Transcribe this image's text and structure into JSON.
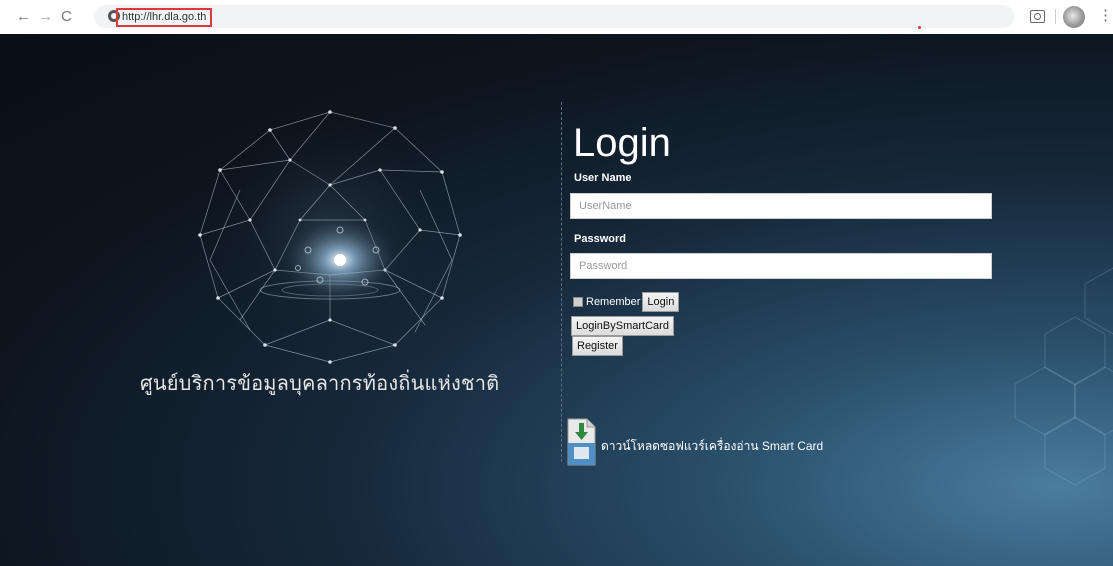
{
  "browser": {
    "url": "http://lhr.dla.go.th",
    "back_icon": "←",
    "forward_icon": "→",
    "reload_icon": "C",
    "menu_icon": "⋮"
  },
  "site": {
    "title": "ศูนย์บริการข้อมูลบุคลากรท้องถิ่นแห่งชาติ"
  },
  "login": {
    "heading": "Login",
    "username_label": "User Name",
    "username_placeholder": "UserName",
    "password_label": "Password",
    "password_placeholder": "Password",
    "remember_label": "Remember",
    "login_button": "Login",
    "smartcard_button": "LoginBySmartCard",
    "register_button": "Register"
  },
  "download": {
    "text": "ดาวน์โหลดซอฟแวร์เครื่องอ่าน Smart Card"
  },
  "colors": {
    "background_dark": "#0a0f15",
    "background_glow": "#4a7d9e",
    "url_highlight": "#d93b3b"
  }
}
